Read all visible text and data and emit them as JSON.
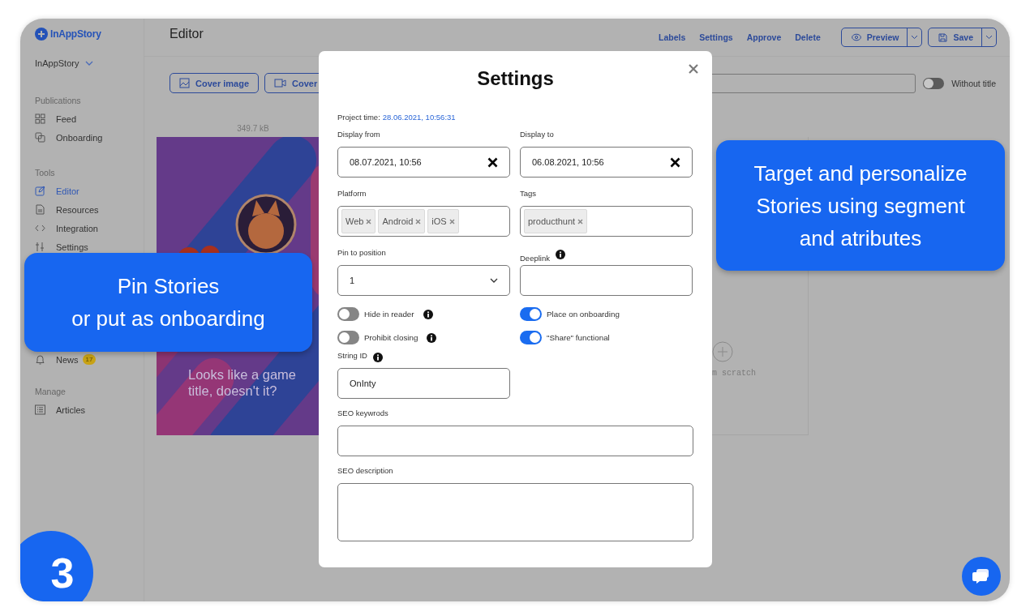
{
  "sidebar": {
    "logo": "InAppStory",
    "workspace": "InAppStory",
    "sections": [
      {
        "title": "Publications",
        "items": [
          {
            "label": "Feed",
            "selected": false
          },
          {
            "label": "Onboarding",
            "selected": false
          }
        ]
      },
      {
        "title": "Tools",
        "items": [
          {
            "label": "Editor",
            "selected": true
          },
          {
            "label": "Resources",
            "selected": false
          },
          {
            "label": "Integration",
            "selected": false
          },
          {
            "label": "Settings",
            "selected": false
          }
        ]
      },
      {
        "items": [
          {
            "label": "News",
            "selected": false,
            "badge": "17"
          }
        ]
      },
      {
        "title": "Manage",
        "items": [
          {
            "label": "Articles",
            "selected": false
          }
        ]
      }
    ]
  },
  "topbar": {
    "title": "Editor",
    "actions": [
      "Labels",
      "Settings",
      "Approve",
      "Delete"
    ],
    "preview": "Preview",
    "save": "Save"
  },
  "editor": {
    "cover_buttons": [
      {
        "label": "Cover image"
      },
      {
        "label": "Cover"
      }
    ],
    "without_title": {
      "label": "Without title",
      "on": false
    },
    "file_size": "349.7 kB",
    "story_caption": "Looks like a game title, doesn't it?",
    "scratch_card": "m scratch"
  },
  "modal": {
    "title": "Settings",
    "project_time_label": "Project time:",
    "project_time": "28.06.2021, 10:56:31",
    "display_from": {
      "label": "Display from",
      "value": "08.07.2021, 10:56"
    },
    "display_to": {
      "label": "Display to",
      "value": "06.08.2021, 10:56"
    },
    "platform": {
      "label": "Platform",
      "chips": [
        "Web",
        "Android",
        "iOS"
      ]
    },
    "tags": {
      "label": "Tags",
      "chips": [
        "producthunt"
      ]
    },
    "pin": {
      "label": "Pin to position",
      "value": "1"
    },
    "deeplink": {
      "label": "Deeplink"
    },
    "toggles": [
      {
        "label": "Hide in reader",
        "on": false,
        "info": true
      },
      {
        "label": "Place on onboarding",
        "on": true,
        "info": false
      },
      {
        "label": "Prohibit closing",
        "on": false,
        "info": true
      },
      {
        "label": "\"Share\" functional",
        "on": true,
        "info": false
      }
    ],
    "string_id": {
      "label": "String ID",
      "value": "OnInty"
    },
    "seo_keywords": {
      "label": "SEO keywrods"
    },
    "seo_description": {
      "label": "SEO description"
    }
  },
  "callouts": [
    {
      "text": "Pin Stories\nor put as onboarding"
    },
    {
      "text": "Target and personalize\nStories using segment\nand atributes"
    }
  ],
  "step_badge": "3"
}
